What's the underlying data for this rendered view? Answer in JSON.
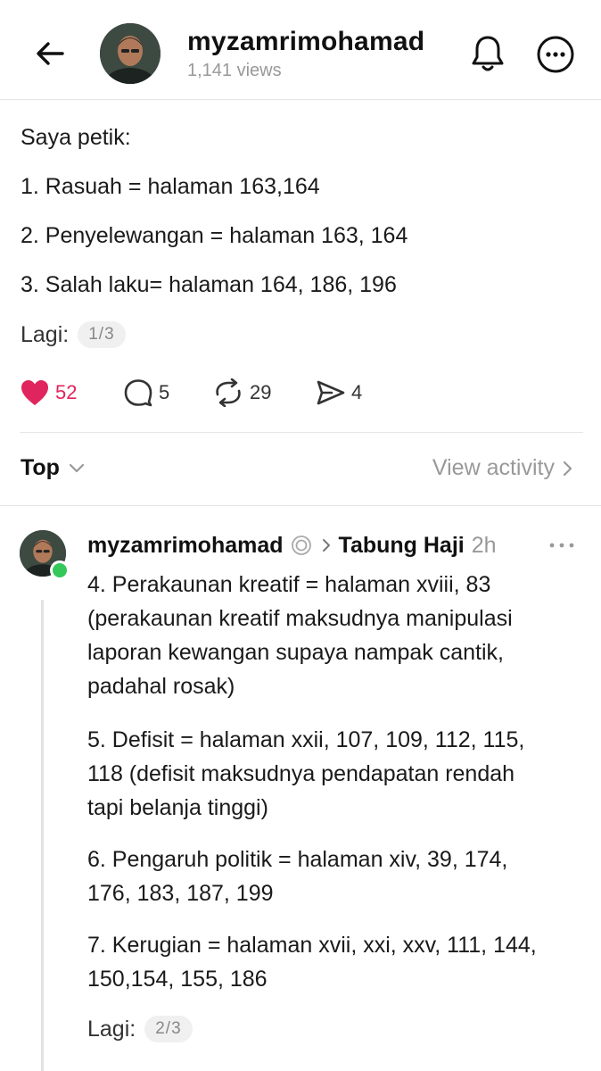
{
  "header": {
    "username": "myzamrimohamad",
    "views": "1,141 views"
  },
  "post": {
    "lines": [
      "Saya petik:",
      "1. Rasuah = halaman 163,164",
      "2. Penyelewangan = halaman 163, 164",
      "3. Salah laku= halaman 164, 186, 196"
    ],
    "more_label": "Lagi:",
    "page_indicator": "1/3",
    "actions": {
      "likes": "52",
      "comments": "5",
      "reposts": "29",
      "shares": "4"
    },
    "like_color": "#e0245e"
  },
  "sort": {
    "label": "Top",
    "view_activity": "View activity"
  },
  "reply": {
    "username": "myzamrimohamad",
    "community": "Tabung Haji",
    "time": "2h",
    "paragraphs": [
      [
        "4. Perakaunan kreatif = halaman xviii, 83",
        "(perakaunan kreatif maksudnya manipulasi",
        "laporan kewangan supaya nampak cantik,",
        "padahal rosak)"
      ],
      [
        "5. Defisit = halaman xxii, 107, 109, 112, 115,",
        "118 (defisit maksudnya pendapatan rendah",
        "tapi belanja tinggi)"
      ],
      [
        "6. Pengaruh politik = halaman xiv, 39, 174,",
        "176, 183, 187, 199"
      ],
      [
        "7. Kerugian = halaman xvii, xxi, xxv, 111, 144,",
        "150,154, 155, 186"
      ]
    ],
    "more_label": "Lagi:",
    "page_indicator": "2/3",
    "online_color": "#34c759"
  },
  "icons": [
    "back-arrow-icon",
    "bell-icon",
    "more-circle-icon",
    "heart-icon",
    "comment-icon",
    "repost-icon",
    "share-icon",
    "chevron-down-icon",
    "chevron-right-icon",
    "threads-badge-icon",
    "more-dots-icon"
  ]
}
